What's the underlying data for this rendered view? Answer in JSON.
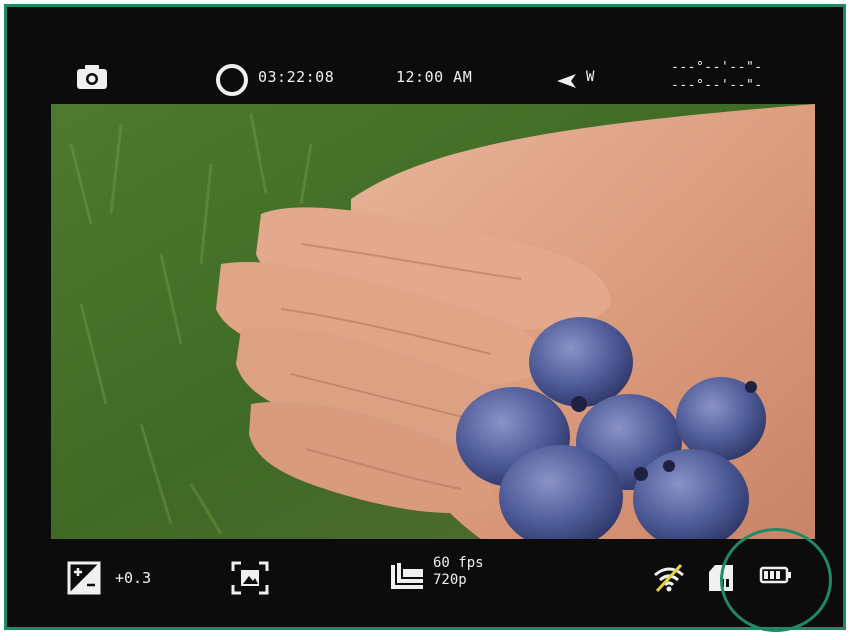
{
  "status_bar": {
    "camera_icon": "camera-icon",
    "record_indicator": "record-ring-icon",
    "recording_time": "03:22:08",
    "clock_time": "12:00 AM",
    "direction_icon": "direction-arrow-icon",
    "direction": "W",
    "latitude": "---°--'--\"-",
    "longitude": "---°--'--\"-"
  },
  "viewfinder": {
    "description_icon": "live-preview"
  },
  "bottom_bar": {
    "exposure_icon": "exposure-compensation-icon",
    "exposure_value": "+0.3",
    "focus_icon": "focus-frame-icon",
    "layers_icon": "layers-icon",
    "frame_rate": "60 fps",
    "resolution": "720p",
    "wifi_icon": "wifi-off-icon",
    "storage_icon": "sd-card-icon",
    "battery_icon": "battery-icon",
    "battery_level": 0.75
  },
  "colors": {
    "frame_border": "#1f8a66",
    "background": "#0c0c0c",
    "text": "#f0f0f0"
  }
}
